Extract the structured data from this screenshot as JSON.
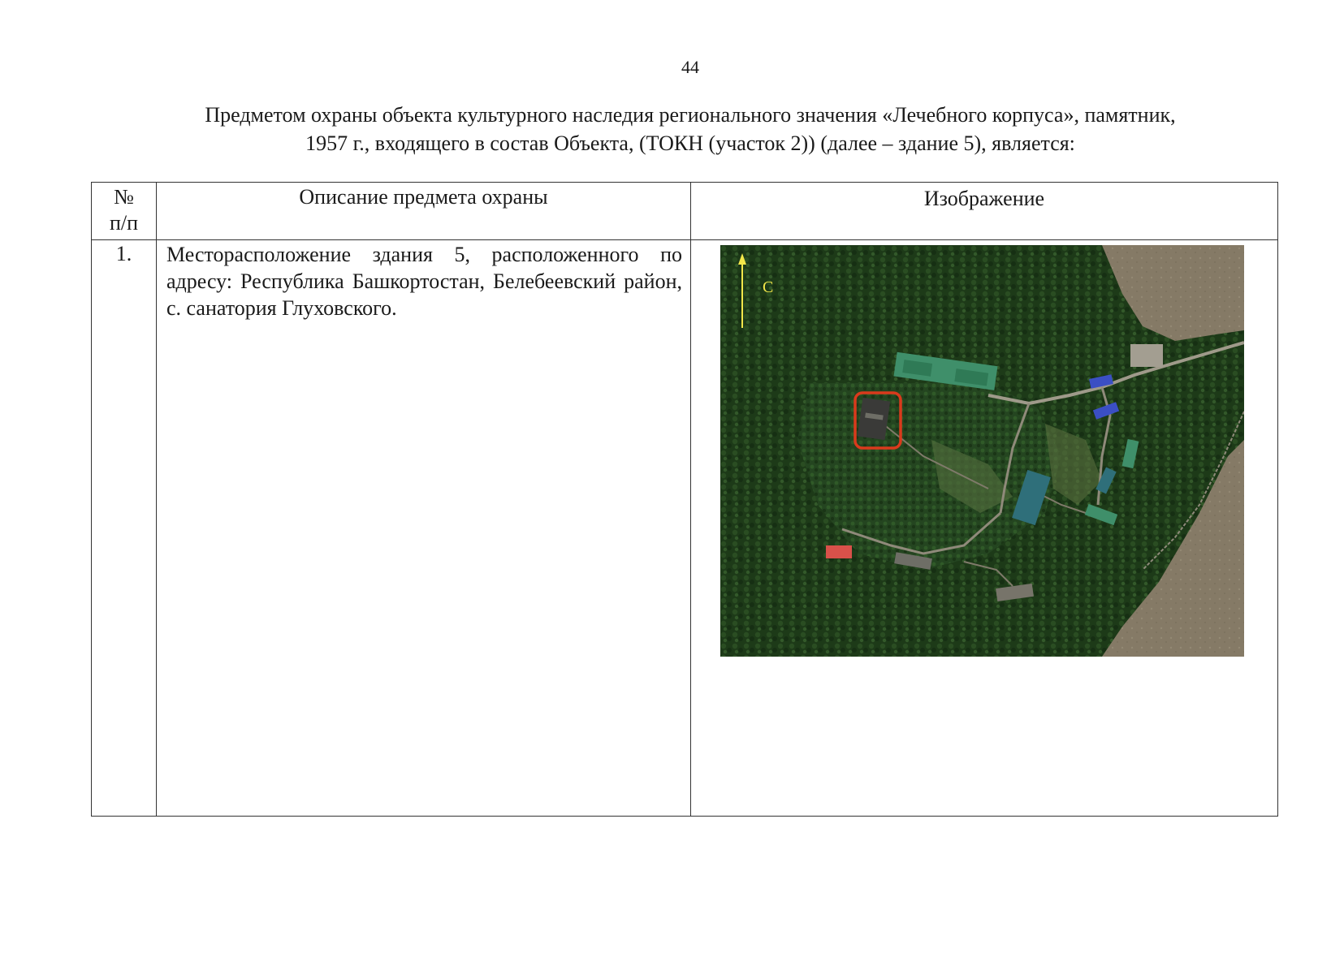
{
  "page": {
    "number": "44"
  },
  "heading": {
    "line1": "Предметом охраны объекта культурного наследия регионального значения «Лечебного корпуса», памятник,",
    "line2": "1957 г., входящего в состав Объекта, (ТОКН (участок 2)) (далее – здание 5), является:"
  },
  "table": {
    "headers": {
      "num_line1": "№",
      "num_line2": "п/п",
      "description": "Описание предмета охраны",
      "image": "Изображение"
    },
    "rows": [
      {
        "num": "1.",
        "description": "Месторасположение здания 5, расположенного по адресу: Республика Башкортостан, Белебеевский район, с. санатория Глуховского."
      }
    ]
  },
  "image": {
    "north_label": "С",
    "colors": {
      "forest": "#1d3a18",
      "meadow": "#8b806c",
      "highlight": "#d93a1c",
      "arrow": "#f2e64a",
      "roof_green": "#3f8f6a",
      "roof_blue": "#3b4fc4",
      "roof_red": "#d9514a"
    }
  }
}
